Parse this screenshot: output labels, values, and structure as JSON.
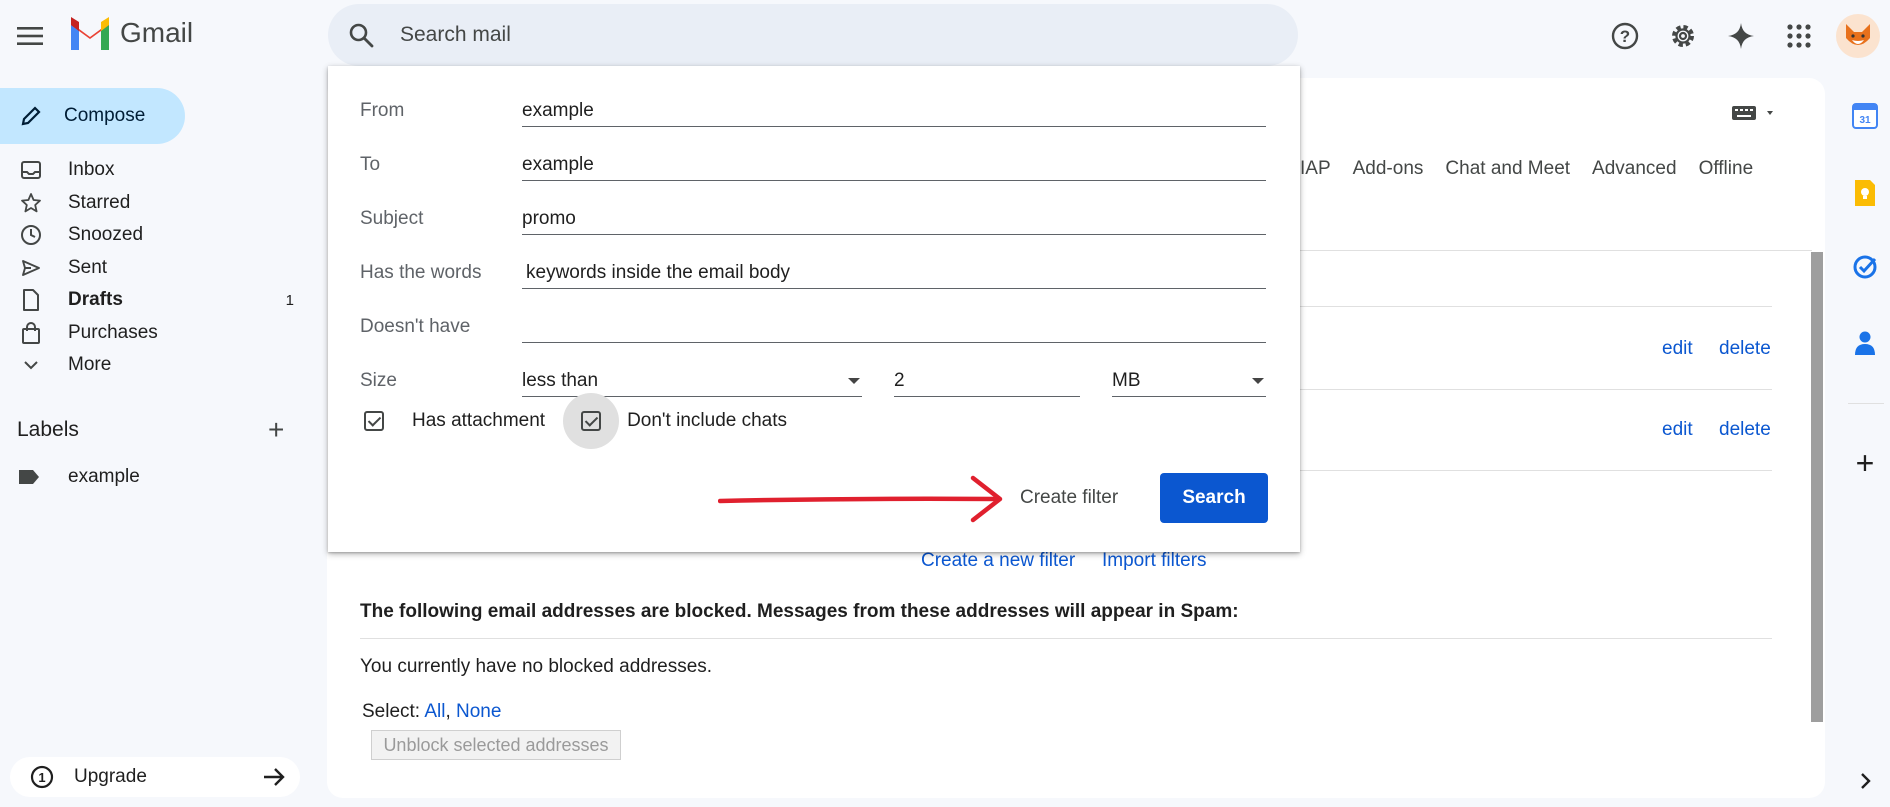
{
  "app": {
    "name": "Gmail"
  },
  "search": {
    "placeholder": "Search mail"
  },
  "compose": {
    "label": "Compose"
  },
  "nav": [
    {
      "label": "Inbox",
      "icon": "inbox-icon",
      "count": ""
    },
    {
      "label": "Starred",
      "icon": "star-icon",
      "count": ""
    },
    {
      "label": "Snoozed",
      "icon": "clock-icon",
      "count": ""
    },
    {
      "label": "Sent",
      "icon": "send-icon",
      "count": ""
    },
    {
      "label": "Drafts",
      "icon": "draft-icon",
      "count": "1"
    },
    {
      "label": "Purchases",
      "icon": "shopping-bag-icon",
      "count": ""
    },
    {
      "label": "More",
      "icon": "chevron-down-icon",
      "count": ""
    }
  ],
  "labels": {
    "heading": "Labels",
    "items": [
      {
        "label": "example"
      }
    ]
  },
  "upgrade": {
    "label": "Upgrade"
  },
  "settings_tabs": [
    "IAP",
    "Add-ons",
    "Chat and Meet",
    "Advanced",
    "Offline"
  ],
  "filters": {
    "rows": [
      {
        "edit": "edit",
        "delete": "delete"
      },
      {
        "edit": "edit",
        "delete": "delete"
      }
    ],
    "create_new": "Create a new filter",
    "import": "Import filters"
  },
  "blocked": {
    "heading": "The following email addresses are blocked. Messages from these addresses will appear in Spam:",
    "empty": "You currently have no blocked addresses.",
    "select_label": "Select:",
    "select_all": "All",
    "select_sep": ",",
    "select_none": "None",
    "unblock_button": "Unblock selected addresses"
  },
  "search_dialog": {
    "from_label": "From",
    "from_value": "example",
    "to_label": "To",
    "to_value": "example",
    "subject_label": "Subject",
    "subject_value": "promo",
    "has_words_label": "Has the words",
    "has_words_value": "keywords inside the email body",
    "doesnt_have_label": "Doesn't have",
    "doesnt_have_value": "",
    "size_label": "Size",
    "size_operator": "less than",
    "size_value": "2",
    "size_unit": "MB",
    "has_attachment_label": "Has attachment",
    "has_attachment_checked": true,
    "dont_include_chats_label": "Don't include chats",
    "dont_include_chats_checked": true,
    "create_filter": "Create filter",
    "search_button": "Search"
  },
  "colors": {
    "accent": "#0b57d0",
    "compose_bg": "#c2e7ff",
    "annotation_arrow": "#e0202e"
  }
}
